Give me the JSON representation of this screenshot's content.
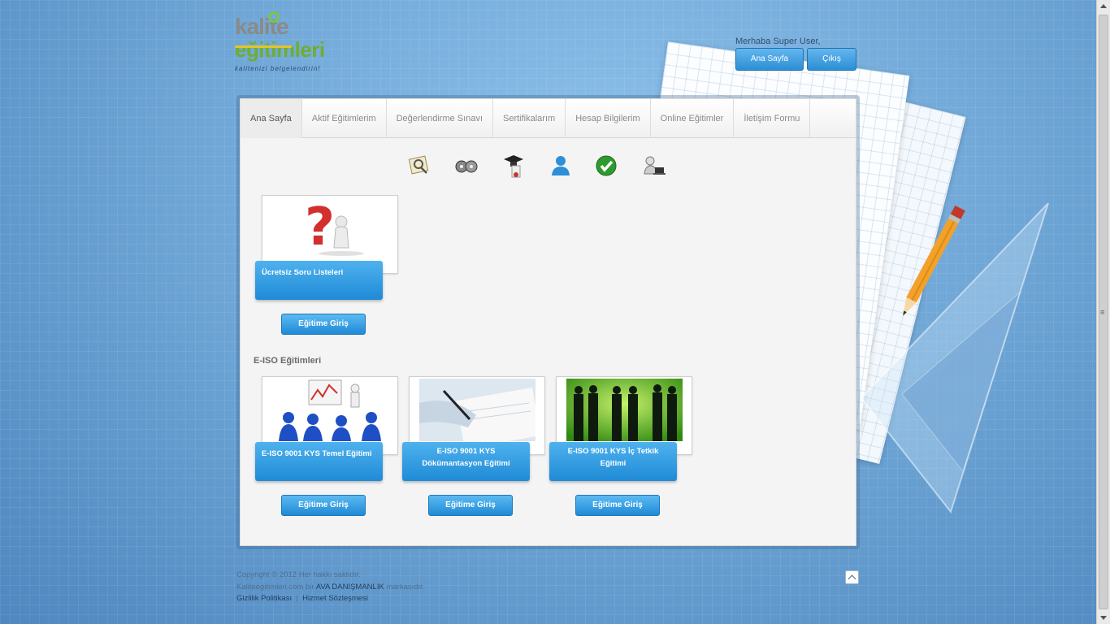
{
  "header": {
    "logo_line1": "kalite",
    "logo_line2": "eğitimleri",
    "logo_tagline": "kalitenizi belgelendirin!",
    "greeting": "Merhaba Super User,",
    "home_button": "Ana Sayfa",
    "logout_button": "Çıkış"
  },
  "tabs": [
    {
      "label": "Ana Sayfa",
      "active": true
    },
    {
      "label": "Aktif Eğitimlerim"
    },
    {
      "label": "Değerlendirme Sınavı"
    },
    {
      "label": "Sertifikalarım"
    },
    {
      "label": "Hesap Bilgilerim"
    },
    {
      "label": "Online Eğitimler"
    },
    {
      "label": "İletişim Formu"
    }
  ],
  "quick_icons": [
    "magnifier-document-icon",
    "film-reels-icon",
    "graduate-certificate-icon",
    "user-icon",
    "checkmark-icon",
    "support-operator-icon"
  ],
  "cards_top": [
    {
      "title": "Ücretsiz Soru Listeleri",
      "button": "Eğitime Giriş",
      "image": "question-mark-figure-image"
    }
  ],
  "section": {
    "title": "E-ISO Eğitimleri"
  },
  "cards_section": [
    {
      "title": "E-ISO 9001 KYS Temel Eğitimi",
      "button": "Eğitime Giriş",
      "image": "presentation-audience-image"
    },
    {
      "title": "E-ISO 9001 KYS Dökümantasyon Eğitimi",
      "button": "Eğitime Giriş",
      "image": "writing-hand-image"
    },
    {
      "title": "E-ISO 9001 KYS İç Tetkik Eğitimi",
      "button": "Eğitime Giriş",
      "image": "business-silhouettes-image"
    }
  ],
  "footer": {
    "copyright": "Copyright © 2012 Her hakkı saklıdır.",
    "brand_prefix": "Kaliteegitimleri.com bir",
    "brand_name": "AVA DANIŞMANLIK",
    "brand_suffix": "markasıdır.",
    "privacy_link": "Gizlilik Politikası",
    "terms_link": "Hizmet Sözleşmesi"
  },
  "colors": {
    "accent_blue": "#2b8fd5",
    "logo_green": "#6fae2f",
    "logo_gray": "#8a8a8a"
  }
}
